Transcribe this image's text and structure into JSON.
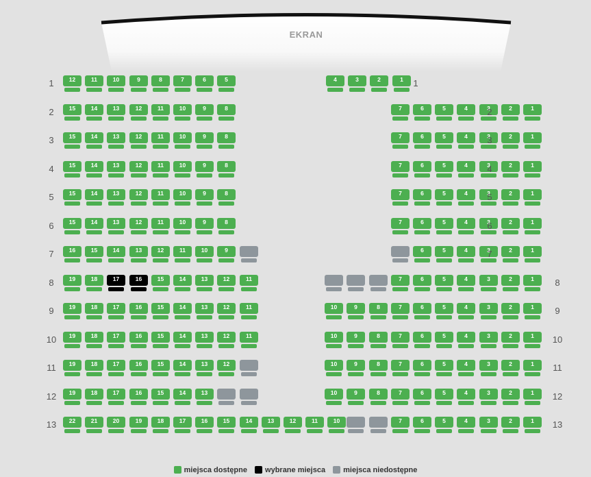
{
  "screen": {
    "label": "EKRAN"
  },
  "colors": {
    "available": "#4caf50",
    "selected": "#000000",
    "unavailable": "#8e969c",
    "background": "#e2e2e2"
  },
  "rows": [
    {
      "label": "1",
      "left": [
        "12",
        "11",
        "10",
        "9",
        "8",
        "7",
        "6",
        "5"
      ],
      "right": [
        "4",
        "3",
        "2",
        "1"
      ]
    },
    {
      "label": "2",
      "left": [
        "15",
        "14",
        "13",
        "12",
        "11",
        "10",
        "9",
        "8"
      ],
      "right": [
        "7",
        "6",
        "5",
        "4",
        "3",
        "2",
        "1"
      ]
    },
    {
      "label": "3",
      "left": [
        "15",
        "14",
        "13",
        "12",
        "11",
        "10",
        "9",
        "8"
      ],
      "right": [
        "7",
        "6",
        "5",
        "4",
        "3",
        "2",
        "1"
      ]
    },
    {
      "label": "4",
      "left": [
        "15",
        "14",
        "13",
        "12",
        "11",
        "10",
        "9",
        "8"
      ],
      "right": [
        "7",
        "6",
        "5",
        "4",
        "3",
        "2",
        "1"
      ]
    },
    {
      "label": "5",
      "left": [
        "15",
        "14",
        "13",
        "12",
        "11",
        "10",
        "9",
        "8"
      ],
      "right": [
        "7",
        "6",
        "5",
        "4",
        "3",
        "2",
        "1"
      ]
    },
    {
      "label": "6",
      "left": [
        "15",
        "14",
        "13",
        "12",
        "11",
        "10",
        "9",
        "8"
      ],
      "right": [
        "7",
        "6",
        "5",
        "4",
        "3",
        "2",
        "1"
      ]
    },
    {
      "label": "7",
      "left": [
        "16",
        "15",
        "14",
        "13",
        "12",
        "11",
        "10",
        "9",
        "X"
      ],
      "right": [
        "X",
        "6",
        "5",
        "4",
        "3",
        "2",
        "1"
      ]
    },
    {
      "label": "8",
      "left": [
        "19",
        "18",
        "S17",
        "S16",
        "15",
        "14",
        "13",
        "12",
        "11"
      ],
      "right": [
        "X",
        "X",
        "X",
        "7",
        "6",
        "5",
        "4",
        "3",
        "2",
        "1"
      ]
    },
    {
      "label": "9",
      "left": [
        "19",
        "18",
        "17",
        "16",
        "15",
        "14",
        "13",
        "12",
        "11"
      ],
      "right": [
        "10",
        "9",
        "8",
        "7",
        "6",
        "5",
        "4",
        "3",
        "2",
        "1"
      ]
    },
    {
      "label": "10",
      "left": [
        "19",
        "18",
        "17",
        "16",
        "15",
        "14",
        "13",
        "12",
        "11"
      ],
      "right": [
        "10",
        "9",
        "8",
        "7",
        "6",
        "5",
        "4",
        "3",
        "2",
        "1"
      ]
    },
    {
      "label": "11",
      "left": [
        "19",
        "18",
        "17",
        "16",
        "15",
        "14",
        "13",
        "12",
        "X"
      ],
      "right": [
        "10",
        "9",
        "8",
        "7",
        "6",
        "5",
        "4",
        "3",
        "2",
        "1"
      ]
    },
    {
      "label": "12",
      "left": [
        "19",
        "18",
        "17",
        "16",
        "15",
        "14",
        "13",
        "X",
        "X"
      ],
      "right": [
        "10",
        "9",
        "8",
        "7",
        "6",
        "5",
        "4",
        "3",
        "2",
        "1"
      ]
    },
    {
      "label": "13",
      "left": [
        "22",
        "21",
        "20",
        "19",
        "18",
        "17",
        "16",
        "15",
        "14",
        "13",
        "12",
        "11",
        "10"
      ],
      "right": [
        "X",
        "X",
        "7",
        "6",
        "5",
        "4",
        "3",
        "2",
        "1"
      ]
    }
  ],
  "legend": {
    "available": "miejsca dostępne",
    "selected": "wybrane miejsca",
    "unavailable": "miejsca niedostępne"
  }
}
